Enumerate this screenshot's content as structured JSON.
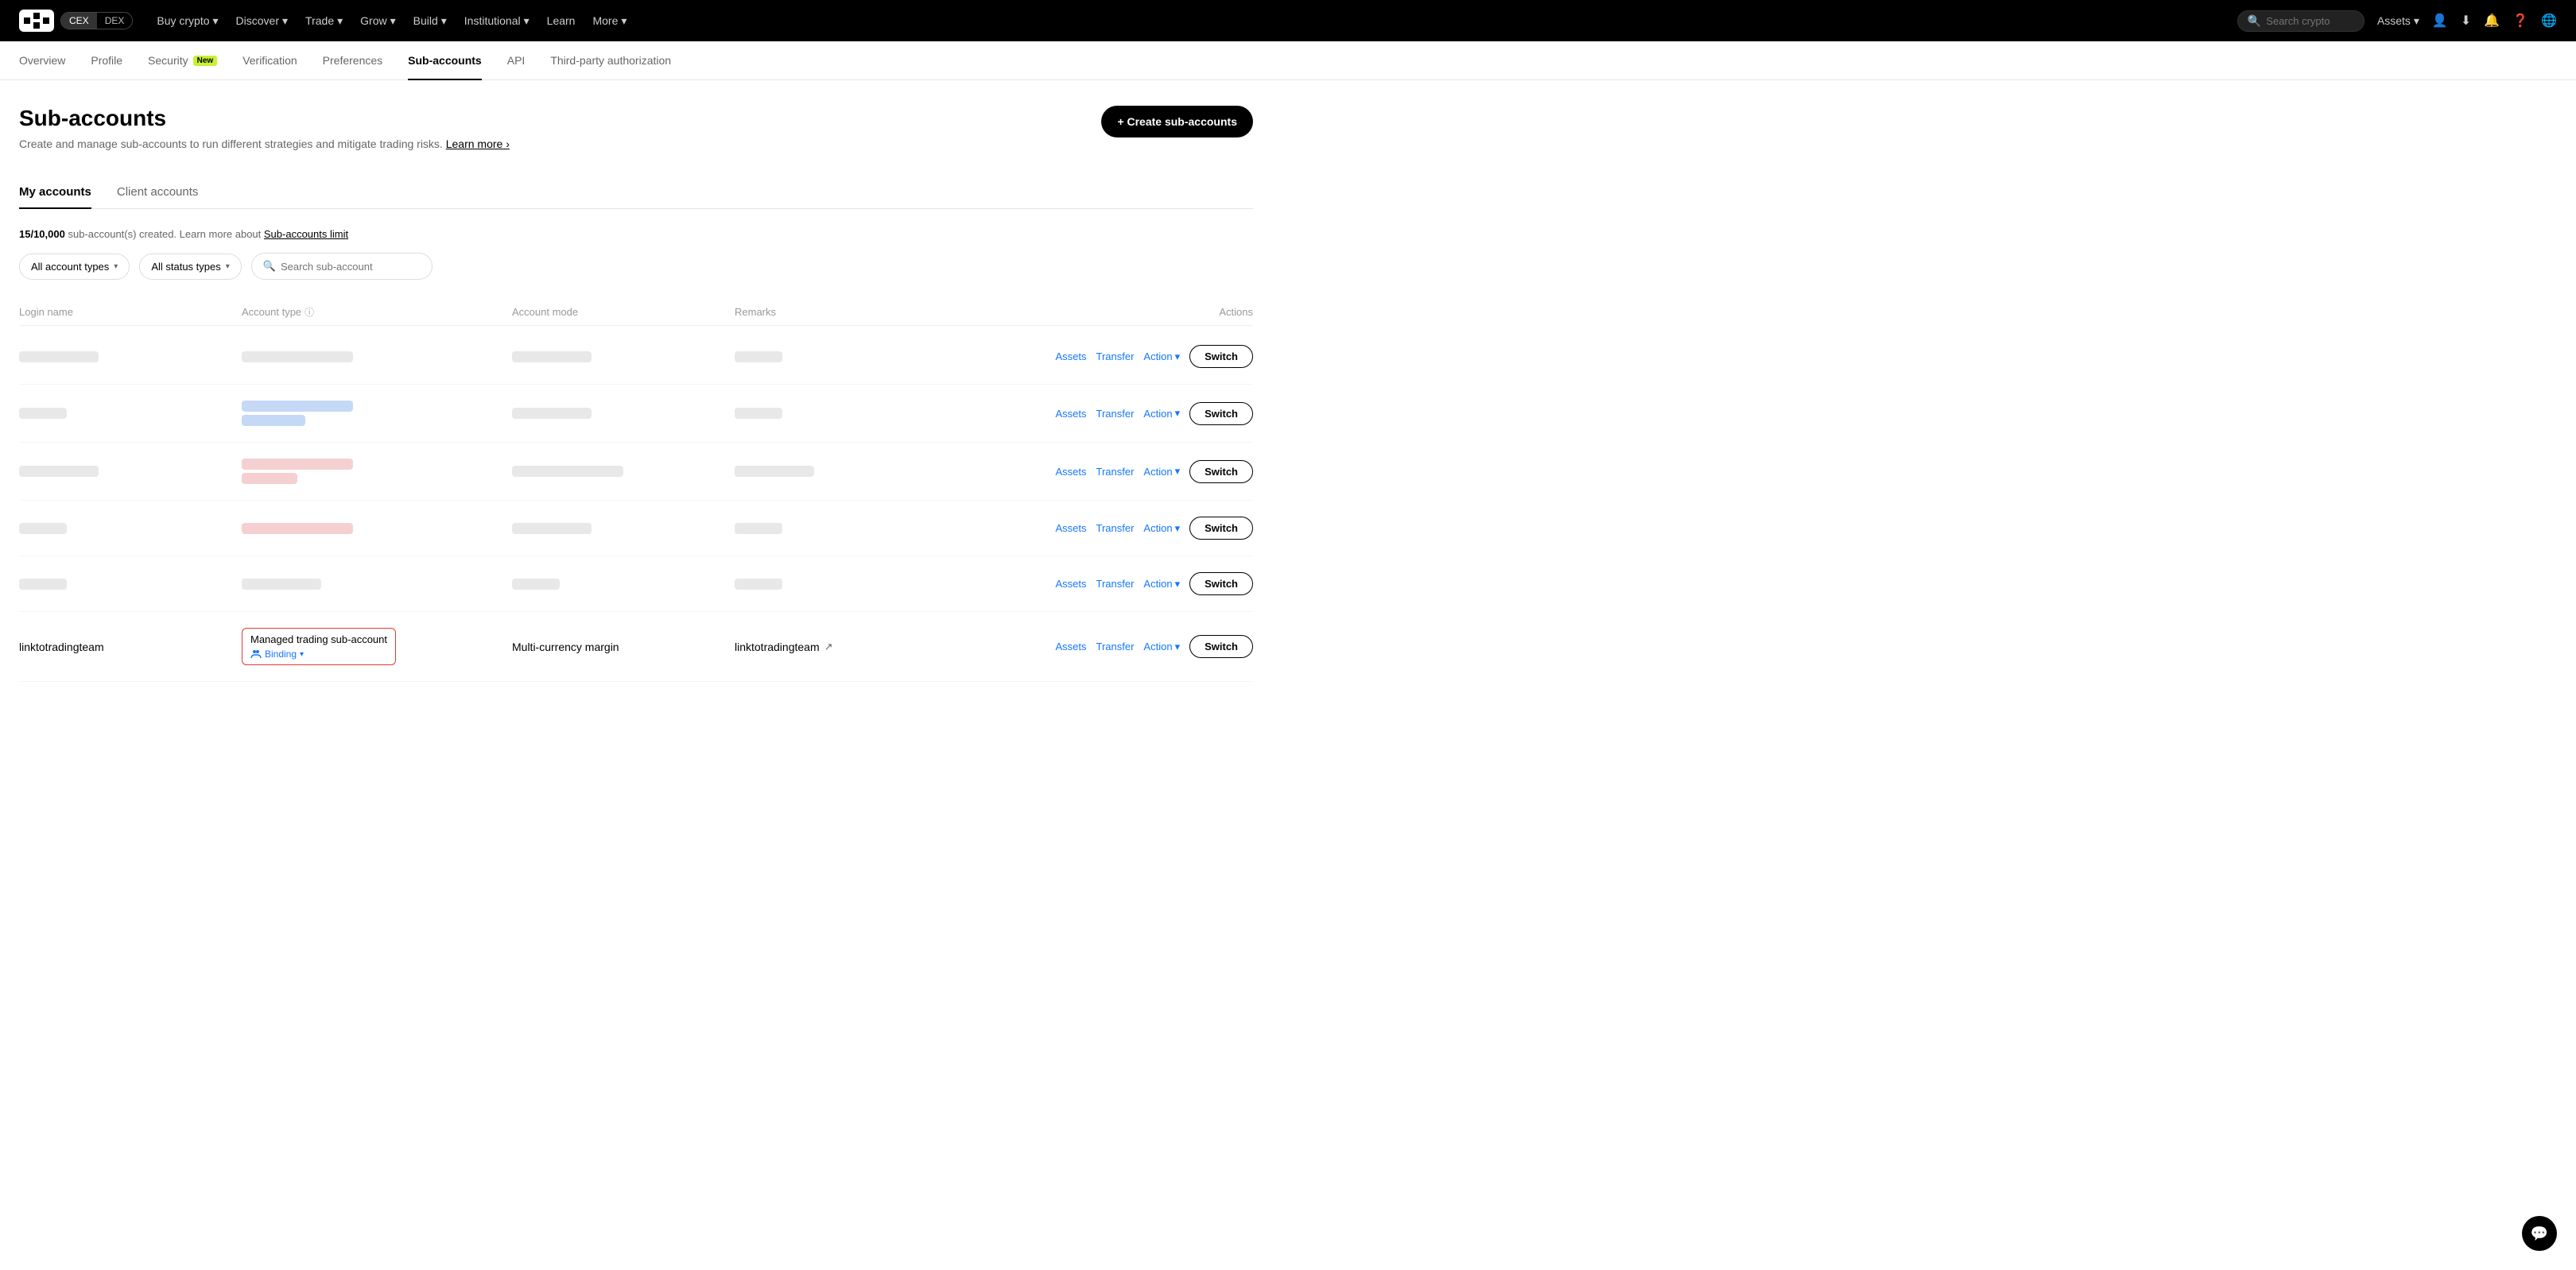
{
  "logo": {
    "text": "OKX",
    "cex": "CEX",
    "dex": "DEX"
  },
  "topNav": {
    "items": [
      {
        "label": "Buy crypto",
        "hasDropdown": true
      },
      {
        "label": "Discover",
        "hasDropdown": true
      },
      {
        "label": "Trade",
        "hasDropdown": true
      },
      {
        "label": "Grow",
        "hasDropdown": true
      },
      {
        "label": "Build",
        "hasDropdown": true
      },
      {
        "label": "Institutional",
        "hasDropdown": true
      },
      {
        "label": "Learn",
        "hasDropdown": false
      },
      {
        "label": "More",
        "hasDropdown": true
      }
    ],
    "search": {
      "placeholder": "Search crypto"
    },
    "assets": "Assets"
  },
  "subNav": {
    "items": [
      {
        "label": "Overview",
        "active": false
      },
      {
        "label": "Profile",
        "active": false
      },
      {
        "label": "Security",
        "active": false,
        "badge": "New"
      },
      {
        "label": "Verification",
        "active": false
      },
      {
        "label": "Preferences",
        "active": false
      },
      {
        "label": "Sub-accounts",
        "active": true
      },
      {
        "label": "API",
        "active": false
      },
      {
        "label": "Third-party authorization",
        "active": false
      }
    ]
  },
  "page": {
    "title": "Sub-accounts",
    "description": "Create and manage sub-accounts to run different strategies and mitigate trading risks.",
    "learnMoreText": "Learn more",
    "createButtonLabel": "+ Create sub-accounts"
  },
  "tabs": [
    {
      "label": "My accounts",
      "active": true
    },
    {
      "label": "Client accounts",
      "active": false
    }
  ],
  "subCount": {
    "text": "15/10,000 sub-account(s) created. Learn more about",
    "linkText": "Sub-accounts limit"
  },
  "filters": {
    "accountType": {
      "label": "All account types"
    },
    "statusType": {
      "label": "All status types"
    },
    "search": {
      "placeholder": "Search sub-account"
    }
  },
  "table": {
    "headers": [
      {
        "label": "Login name"
      },
      {
        "label": "Account type",
        "hasInfo": true
      },
      {
        "label": "Account mode"
      },
      {
        "label": "Remarks"
      },
      {
        "label": "Actions",
        "align": "right"
      }
    ],
    "rows": [
      {
        "id": 1,
        "skeleton": true,
        "skeletonType": "normal"
      },
      {
        "id": 2,
        "skeleton": true,
        "skeletonType": "double"
      },
      {
        "id": 3,
        "skeleton": true,
        "skeletonType": "double-pink"
      },
      {
        "id": 4,
        "skeleton": true,
        "skeletonType": "single-pink"
      },
      {
        "id": 5,
        "skeleton": true,
        "skeletonType": "normal"
      },
      {
        "id": 6,
        "skeleton": false,
        "loginName": "linktotradingteam",
        "accountType": "Managed trading sub-account",
        "accountTypeHighlighted": true,
        "bindingLabel": "Binding",
        "accountMode": "Multi-currency margin",
        "remarks": "linktotradingteam",
        "hasExternalLink": true
      }
    ],
    "actionLabels": {
      "assets": "Assets",
      "transfer": "Transfer",
      "action": "Action",
      "switch": "Switch"
    }
  },
  "chat": {
    "icon": "💬"
  }
}
